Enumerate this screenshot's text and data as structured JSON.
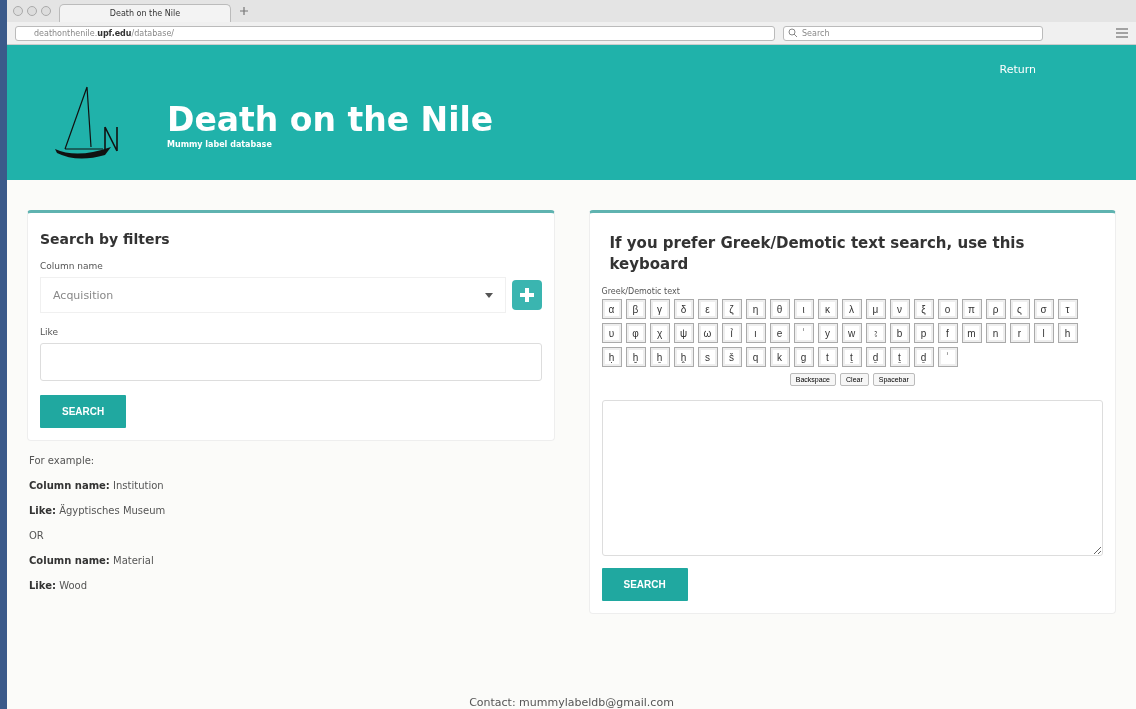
{
  "browser": {
    "tab_title": "Death on the Nile",
    "url_host": "deathonthenile.",
    "url_domain": "upf.edu",
    "url_path": "/database/",
    "search_placeholder": "Search"
  },
  "header": {
    "title": "Death on the Nile",
    "subtitle": "Mummy label database",
    "nav_link": "Return"
  },
  "filters": {
    "title": "Search by filters",
    "column_label": "Column name",
    "column_value": "Acquisition",
    "like_label": "Like",
    "button": "SEARCH",
    "examples": [
      "For example:",
      "**Column name:** Institution",
      "**Like:** Ägyptisches Museum",
      "OR",
      "**Column name:** Material",
      "**Like:** Wood"
    ]
  },
  "keyboard_panel": {
    "title": "If you prefer Greek/Demotic text search, use this keyboard",
    "keyboard_label": "Greek/Demotic text",
    "key_rows": [
      [
        "α",
        "β",
        "γ",
        "δ",
        "ε",
        "ζ",
        "η",
        "θ",
        "ι",
        "κ",
        "λ",
        "μ",
        "ν",
        "ξ",
        "ο",
        "π",
        "ρ",
        "ς",
        "σ",
        "τ"
      ],
      [
        "υ",
        "φ",
        "χ",
        "ψ",
        "ω",
        "ỉ",
        "ı",
        "e",
        "ʿ",
        "y",
        "w",
        "ꜣ",
        "b",
        "p",
        "f",
        "m",
        "n",
        "r",
        "l",
        "h"
      ],
      [
        "ḥ",
        "ḫ",
        "ẖ",
        "h̭",
        "s",
        "š",
        "q",
        "k",
        "g",
        "t",
        "ṯ",
        "ḏ",
        "ṯ",
        "ḏ",
        "ʾ"
      ]
    ],
    "actions": [
      "Backspace",
      "Clear",
      "Spacebar"
    ],
    "button": "SEARCH"
  },
  "footer": {
    "contact": "Contact: mummylabeldb@gmail.com"
  }
}
